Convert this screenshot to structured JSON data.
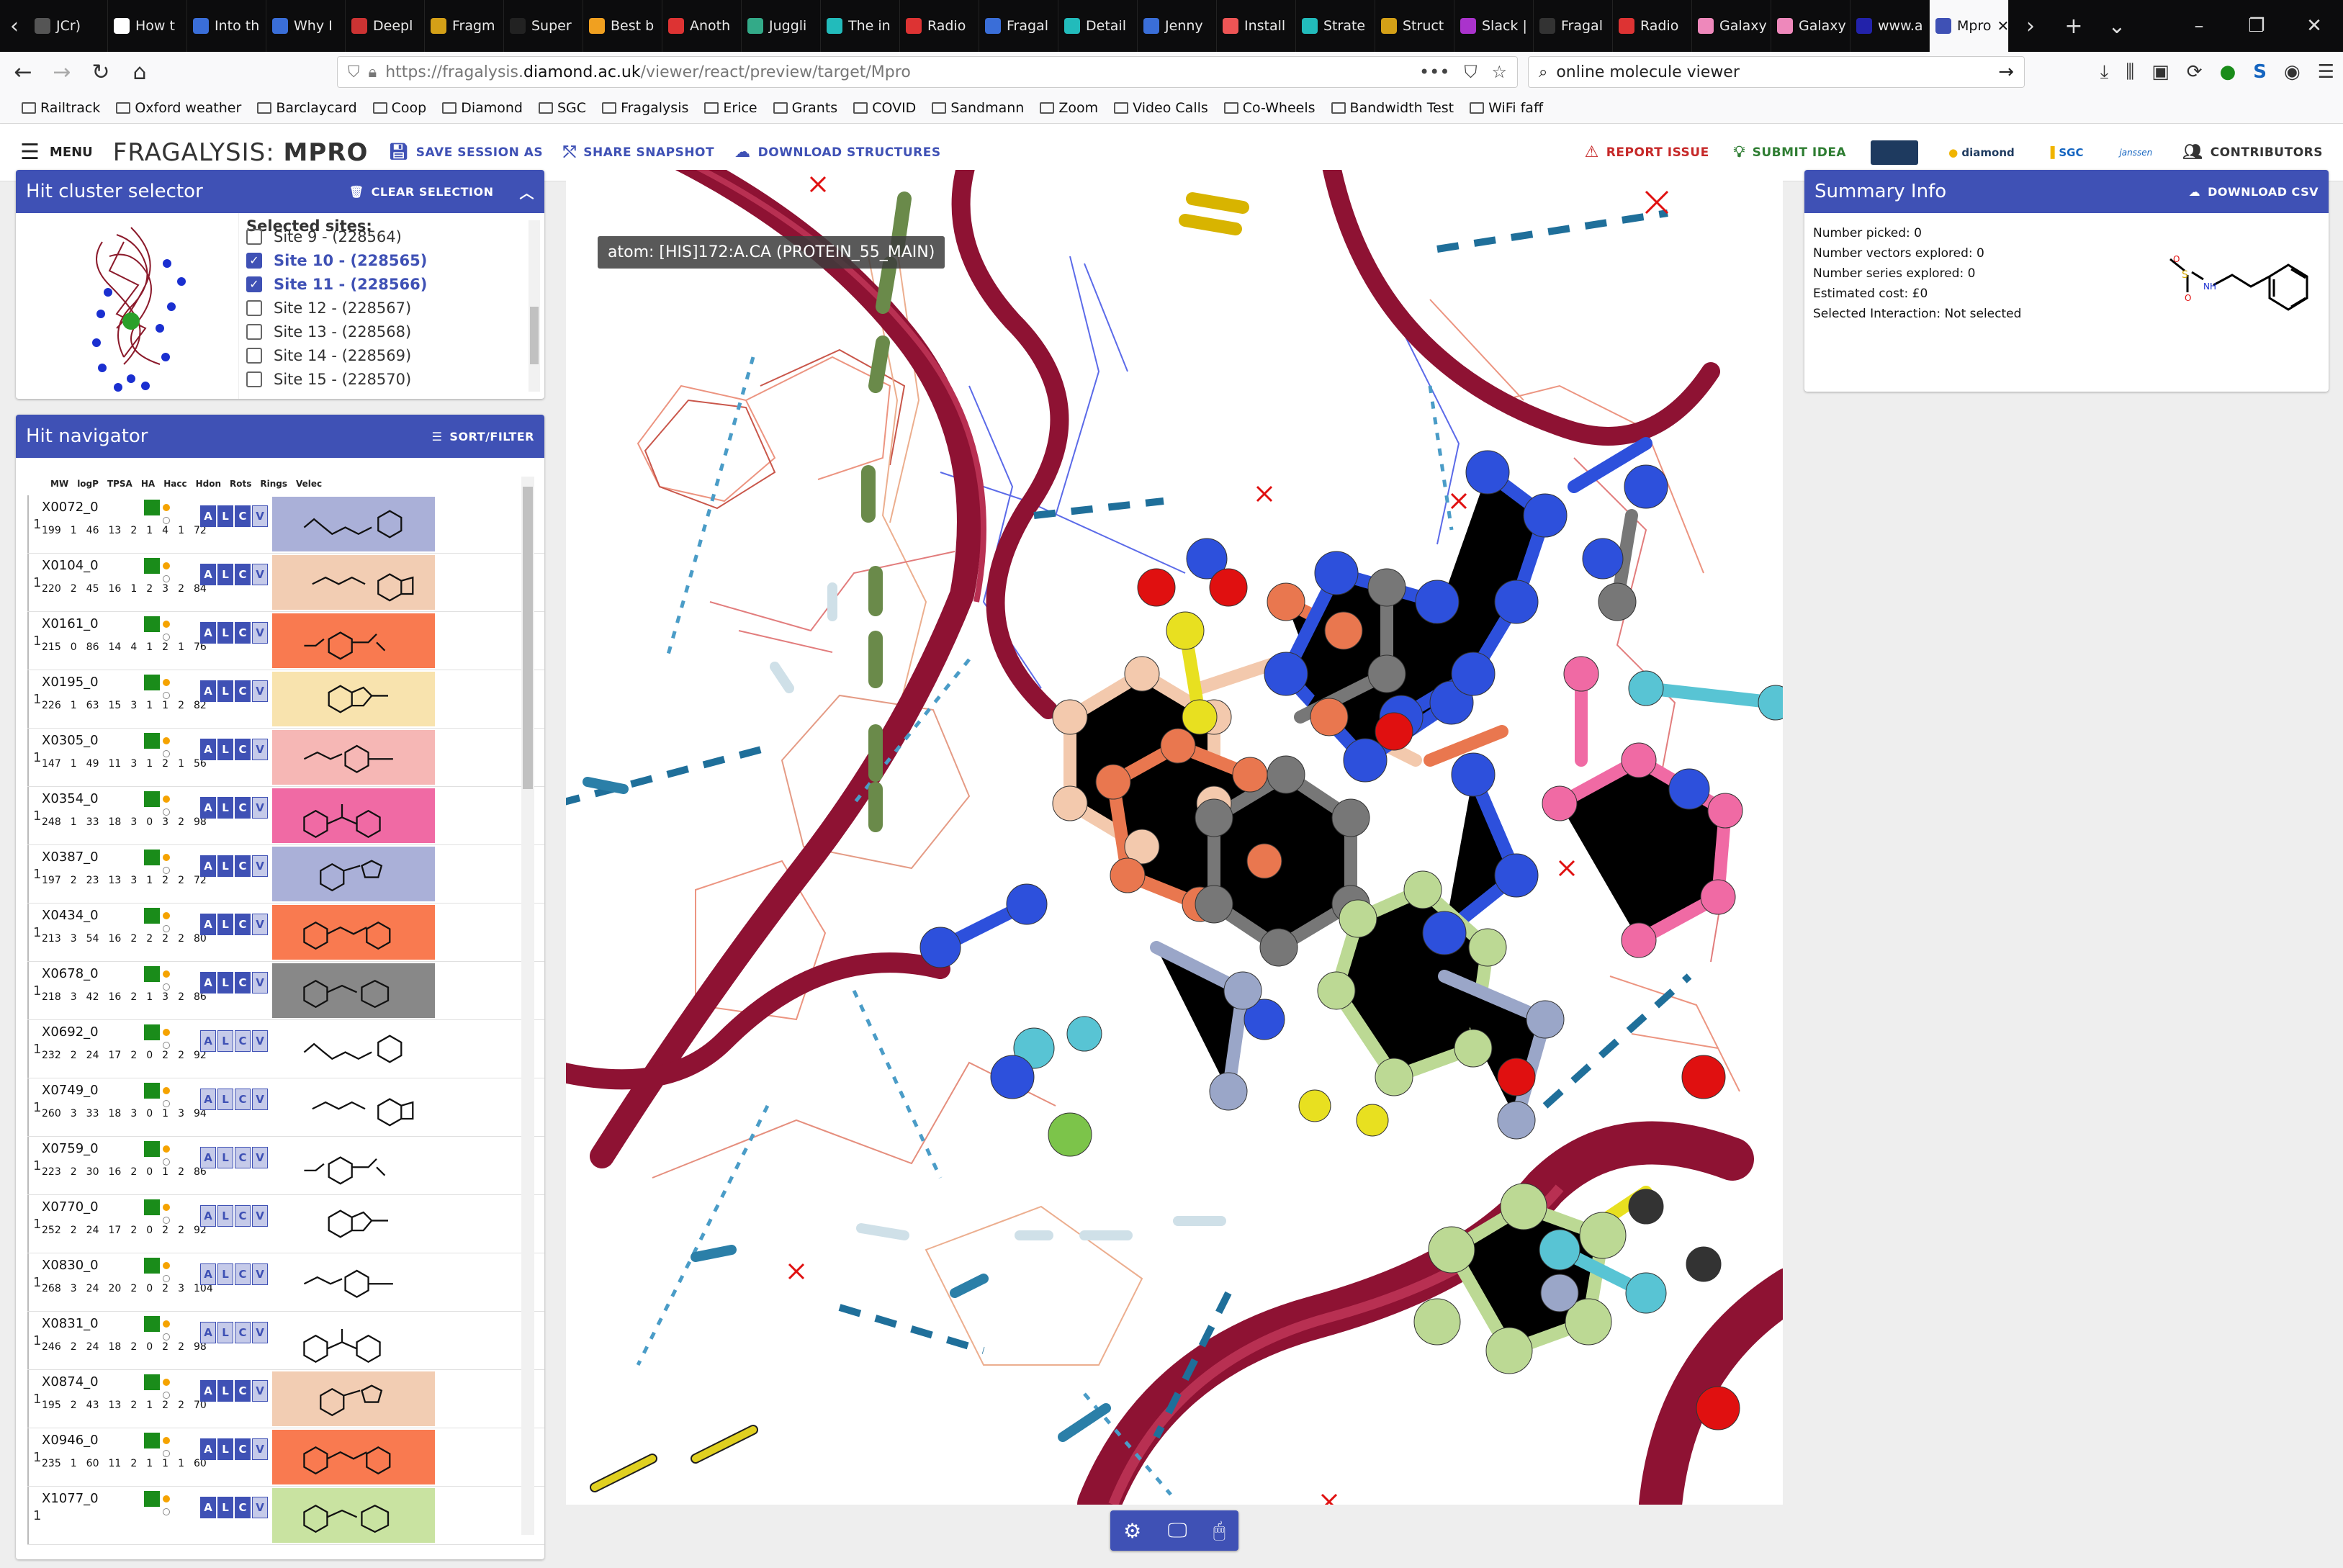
{
  "browser": {
    "tabs": [
      {
        "label": "JCr)",
        "color": "#555"
      },
      {
        "label": "How t",
        "color": "#fff"
      },
      {
        "label": "Into th",
        "color": "#3a6ed8"
      },
      {
        "label": "Why I",
        "color": "#3a6ed8"
      },
      {
        "label": "Deepl",
        "color": "#c33"
      },
      {
        "label": "Fragm",
        "color": "#d4a017"
      },
      {
        "label": "Super",
        "color": "#222"
      },
      {
        "label": "Best b",
        "color": "#f0a020"
      },
      {
        "label": "Anoth",
        "color": "#d33"
      },
      {
        "label": "Juggli",
        "color": "#3a8"
      },
      {
        "label": "The in",
        "color": "#2bb"
      },
      {
        "label": "Radio",
        "color": "#d33"
      },
      {
        "label": "Fragal",
        "color": "#3a6ed8"
      },
      {
        "label": "Detail",
        "color": "#2bb"
      },
      {
        "label": "Jenny",
        "color": "#3a6ed8"
      },
      {
        "label": "Install",
        "color": "#e55"
      },
      {
        "label": "Strate",
        "color": "#2bb"
      },
      {
        "label": "Struct",
        "color": "#d4a017"
      },
      {
        "label": "Slack |",
        "color": "#a3c"
      },
      {
        "label": "Fragal",
        "color": "#333"
      },
      {
        "label": "Radio",
        "color": "#d33"
      },
      {
        "label": "Galaxy",
        "color": "#e8b"
      },
      {
        "label": "Galaxy",
        "color": "#e8b"
      },
      {
        "label": "www.a",
        "color": "#22a"
      },
      {
        "label": "Mpro",
        "color": "#3f51b5",
        "active": true
      }
    ],
    "url_prefix": "https://fragalysis.",
    "url_domain": "diamond.ac.uk",
    "url_path": "/viewer/react/preview/target/Mpro",
    "search_value": "online molecule viewer",
    "bookmarks": [
      "Railtrack",
      "Oxford weather",
      "Barclaycard",
      "Coop",
      "Diamond",
      "SGC",
      "Fragalysis",
      "Erice",
      "Grants",
      "COVID",
      "Sandmann",
      "Zoom",
      "Video Calls",
      "Co-Wheels",
      "Bandwidth Test",
      "WiFi faff"
    ]
  },
  "app": {
    "menu_label": "MENU",
    "brand_light": "FRAGALYSIS: ",
    "brand_bold": "MPRO",
    "save_label": "SAVE SESSION AS",
    "share_label": "SHARE SNAPSHOT",
    "download_label": "DOWNLOAD STRUCTURES",
    "report_label": "REPORT ISSUE",
    "idea_label": "SUBMIT IDEA",
    "contributors_label": "CONTRIBUTORS",
    "logos": [
      "diamond",
      "SGC",
      "janssen"
    ]
  },
  "cluster": {
    "title": "Hit cluster selector",
    "clear_label": "CLEAR SELECTION",
    "selected_label": "Selected sites:",
    "sites": [
      {
        "label": "Site 9 - (228564)",
        "checked": false
      },
      {
        "label": "Site 10 - (228565)",
        "checked": true
      },
      {
        "label": "Site 11 - (228566)",
        "checked": true
      },
      {
        "label": "Site 12 - (228567)",
        "checked": false
      },
      {
        "label": "Site 13 - (228568)",
        "checked": false
      },
      {
        "label": "Site 14 - (228569)",
        "checked": false
      },
      {
        "label": "Site 15 - (228570)",
        "checked": false
      }
    ]
  },
  "navigator": {
    "title": "Hit navigator",
    "sort_label": "SORT/FILTER",
    "columns": [
      "MW",
      "logP",
      "TPSA",
      "HA",
      "Hacc",
      "Hdon",
      "Rots",
      "Rings",
      "Velec"
    ],
    "hits": [
      {
        "code": "X0072_0",
        "props": [
          "199",
          "1",
          "46",
          "13",
          "2",
          "1",
          "4",
          "1",
          "72"
        ],
        "bg": "#aab0d8",
        "alcv": [
          true,
          true,
          true,
          false
        ]
      },
      {
        "code": "X0104_0",
        "props": [
          "220",
          "2",
          "45",
          "16",
          "1",
          "2",
          "3",
          "2",
          "84"
        ],
        "bg": "#f2cdb3",
        "alcv": [
          true,
          true,
          true,
          false
        ]
      },
      {
        "code": "X0161_0",
        "props": [
          "215",
          "0",
          "86",
          "14",
          "4",
          "1",
          "2",
          "1",
          "76"
        ],
        "bg": "#f97a50",
        "alcv": [
          true,
          true,
          true,
          false
        ]
      },
      {
        "code": "X0195_0",
        "props": [
          "226",
          "1",
          "63",
          "15",
          "3",
          "1",
          "1",
          "2",
          "82"
        ],
        "bg": "#f8e3ae",
        "alcv": [
          true,
          true,
          true,
          false
        ]
      },
      {
        "code": "X0305_0",
        "props": [
          "147",
          "1",
          "49",
          "11",
          "3",
          "1",
          "2",
          "1",
          "56"
        ],
        "bg": "#f6b7b5",
        "alcv": [
          true,
          true,
          true,
          false
        ]
      },
      {
        "code": "X0354_0",
        "props": [
          "248",
          "1",
          "33",
          "18",
          "3",
          "0",
          "3",
          "2",
          "98"
        ],
        "bg": "#f06aa4",
        "alcv": [
          true,
          true,
          true,
          false
        ]
      },
      {
        "code": "X0387_0",
        "props": [
          "197",
          "2",
          "23",
          "13",
          "3",
          "1",
          "2",
          "2",
          "72"
        ],
        "bg": "#aab0d8",
        "alcv": [
          true,
          true,
          true,
          false
        ]
      },
      {
        "code": "X0434_0",
        "props": [
          "213",
          "3",
          "54",
          "16",
          "2",
          "2",
          "2",
          "2",
          "80"
        ],
        "bg": "#f97a50",
        "alcv": [
          true,
          true,
          true,
          false
        ]
      },
      {
        "code": "X0678_0",
        "props": [
          "218",
          "3",
          "42",
          "16",
          "2",
          "1",
          "3",
          "2",
          "86"
        ],
        "bg": "#888",
        "alcv": [
          true,
          true,
          true,
          false
        ]
      },
      {
        "code": "X0692_0",
        "props": [
          "232",
          "2",
          "24",
          "17",
          "2",
          "0",
          "2",
          "2",
          "92"
        ],
        "bg": "#fff",
        "alcv": [
          false,
          false,
          false,
          false
        ]
      },
      {
        "code": "X0749_0",
        "props": [
          "260",
          "3",
          "33",
          "18",
          "3",
          "0",
          "1",
          "3",
          "94"
        ],
        "bg": "#fff",
        "alcv": [
          false,
          false,
          false,
          false
        ]
      },
      {
        "code": "X0759_0",
        "props": [
          "223",
          "2",
          "30",
          "16",
          "2",
          "0",
          "1",
          "2",
          "86"
        ],
        "bg": "#fff",
        "alcv": [
          false,
          false,
          false,
          false
        ]
      },
      {
        "code": "X0770_0",
        "props": [
          "252",
          "2",
          "24",
          "17",
          "2",
          "0",
          "2",
          "2",
          "92"
        ],
        "bg": "#fff",
        "alcv": [
          false,
          false,
          false,
          false
        ]
      },
      {
        "code": "X0830_0",
        "props": [
          "268",
          "3",
          "24",
          "20",
          "2",
          "0",
          "2",
          "3",
          "104"
        ],
        "bg": "#fff",
        "alcv": [
          false,
          false,
          false,
          false
        ]
      },
      {
        "code": "X0831_0",
        "props": [
          "246",
          "2",
          "24",
          "18",
          "2",
          "0",
          "2",
          "2",
          "98"
        ],
        "bg": "#fff",
        "alcv": [
          false,
          false,
          false,
          false
        ]
      },
      {
        "code": "X0874_0",
        "props": [
          "195",
          "2",
          "43",
          "13",
          "2",
          "1",
          "2",
          "2",
          "70"
        ],
        "bg": "#f2cdb3",
        "alcv": [
          true,
          true,
          true,
          false
        ]
      },
      {
        "code": "X0946_0",
        "props": [
          "235",
          "1",
          "60",
          "11",
          "2",
          "1",
          "1",
          "1",
          "60"
        ],
        "bg": "#f97a50",
        "alcv": [
          true,
          true,
          true,
          false
        ]
      },
      {
        "code": "X1077_0",
        "props": [
          "",
          "",
          "",
          "",
          "",
          "",
          "",
          "",
          ""
        ],
        "bg": "#c9e3a1",
        "alcv": [
          true,
          true,
          true,
          false
        ]
      }
    ]
  },
  "viewer": {
    "tooltip": "atom: [HIS]172:A.CA (PROTEIN_55_MAIN)"
  },
  "summary": {
    "title": "Summary Info",
    "download_label": "DOWNLOAD CSV",
    "lines": [
      "Number picked: 0",
      "Number vectors explored: 0",
      "Number series explored: 0",
      "Estimated cost: £0",
      "Selected Interaction: Not selected"
    ]
  }
}
